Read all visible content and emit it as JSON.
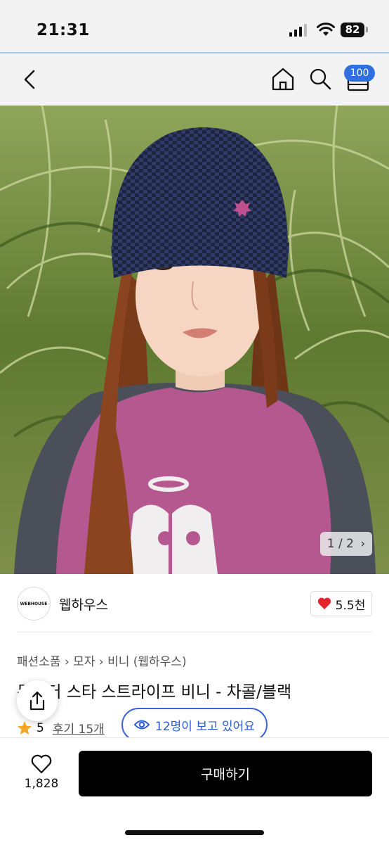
{
  "status_bar": {
    "time": "21:31",
    "battery": "82"
  },
  "nav": {
    "cart_badge": "100",
    "icons": [
      "back-icon",
      "home-icon",
      "search-icon",
      "shopping-bag-icon"
    ]
  },
  "gallery": {
    "counter": "1 / 2"
  },
  "seller": {
    "logo_text": "WEBHOUSE",
    "name": "웹하우스",
    "likes": "5.5천"
  },
  "product": {
    "breadcrumb": [
      "패션소품",
      "모자",
      "비니 (웹하우스)"
    ],
    "title": "몬스터 스타 스트라이프 비니 - 차콜/블랙",
    "rating": "5",
    "reviews": "후기 15개",
    "viewers": "12명이 보고 있어요"
  },
  "bottom": {
    "wish_count": "1,828",
    "buy_label": "구매하기"
  },
  "colors": {
    "accent": "#2f6fe0",
    "heart": "#e3242b",
    "star": "#f5a623",
    "buy": "#000000"
  }
}
